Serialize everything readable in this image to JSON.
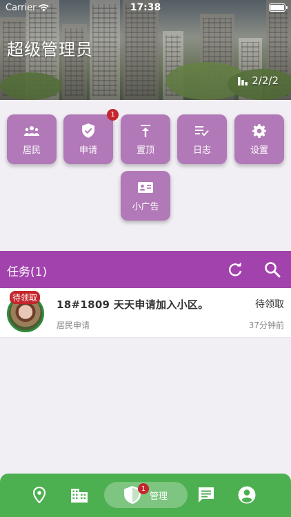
{
  "status_bar": {
    "carrier": "Carrier",
    "time": "17:38"
  },
  "header": {
    "title": "超级管理员",
    "stat": "2/2/2"
  },
  "grid": [
    {
      "label": "居民",
      "icon": "people-icon"
    },
    {
      "label": "申请",
      "icon": "shield-check-icon",
      "badge": "1"
    },
    {
      "label": "置顶",
      "icon": "pin-top-icon"
    },
    {
      "label": "日志",
      "icon": "log-list-icon"
    },
    {
      "label": "设置",
      "icon": "gear-icon"
    },
    {
      "label": "小广告",
      "icon": "id-card-icon"
    }
  ],
  "tasks": {
    "title": "任务(1)",
    "items": [
      {
        "tag": "待领取",
        "title": "18#1809 天天申请加入小区。",
        "subtitle": "居民申请",
        "status": "待领取",
        "time": "37分钟前"
      }
    ]
  },
  "bottom_nav": {
    "items": [
      {
        "icon": "location-pin-icon"
      },
      {
        "icon": "building-icon"
      },
      {
        "icon": "shield-icon",
        "label": "管理",
        "badge": "1",
        "active": true
      },
      {
        "icon": "chat-icon"
      },
      {
        "icon": "account-icon"
      }
    ]
  },
  "colors": {
    "accent": "#a243ad",
    "tile": "#b279b8",
    "nav": "#4caf50",
    "badge": "#c4262e"
  }
}
